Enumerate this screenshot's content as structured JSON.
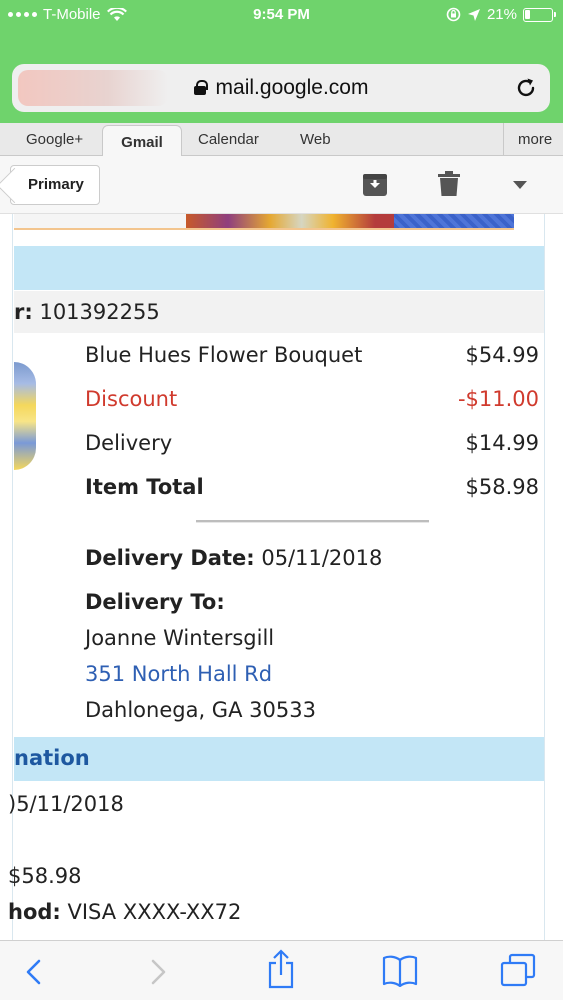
{
  "status_bar": {
    "carrier": "T-Mobile",
    "time": "9:54 PM",
    "battery": "21%",
    "battery_level": 0.21
  },
  "browser": {
    "url": "mail.google.com",
    "icons": [
      "lock-icon",
      "reload-icon"
    ]
  },
  "gmail_tabs": {
    "tabs": [
      "Google+",
      "Gmail",
      "Calendar",
      "Web"
    ],
    "more": "more",
    "active": "Gmail"
  },
  "mail_toolbar": {
    "back_label": "Primary",
    "icons": [
      "archive-icon",
      "trash-icon",
      "dropdown-arrow-icon"
    ]
  },
  "email": {
    "order_label": "r:",
    "order_number": "101392255",
    "line_items": [
      {
        "name": "Blue Hues Flower Bouquet",
        "price": "$54.99"
      },
      {
        "name": "Discount",
        "price": "-$11.00"
      },
      {
        "name": "Delivery",
        "price": "$14.99"
      },
      {
        "name": "Item Total",
        "price": "$58.98"
      }
    ],
    "delivery_date_label": "Delivery Date:",
    "delivery_date": "05/11/2018",
    "delivery_to_label": "Delivery To:",
    "recipient": "Joanne Wintersgill",
    "address_line1": "351 North Hall Rd",
    "address_line2": "Dahlonega, GA 30533",
    "section_title": "nation",
    "payment_date": ")5/11/2018",
    "payment_total": "$58.98",
    "payment_method_label": "hod:",
    "payment_method": "VISA XXXX-XX72"
  },
  "colors": {
    "status_green": "#6fd36c",
    "band_blue": "#c3e6f6",
    "discount_red": "#d03a2d",
    "link_blue": "#2e5fb3",
    "section_blue": "#1e58a0",
    "ios_blue": "#2f7bf6"
  },
  "bottom_toolbar": {
    "icons": [
      "back-icon",
      "forward-icon",
      "share-icon",
      "bookmarks-icon",
      "tabs-icon"
    ]
  }
}
